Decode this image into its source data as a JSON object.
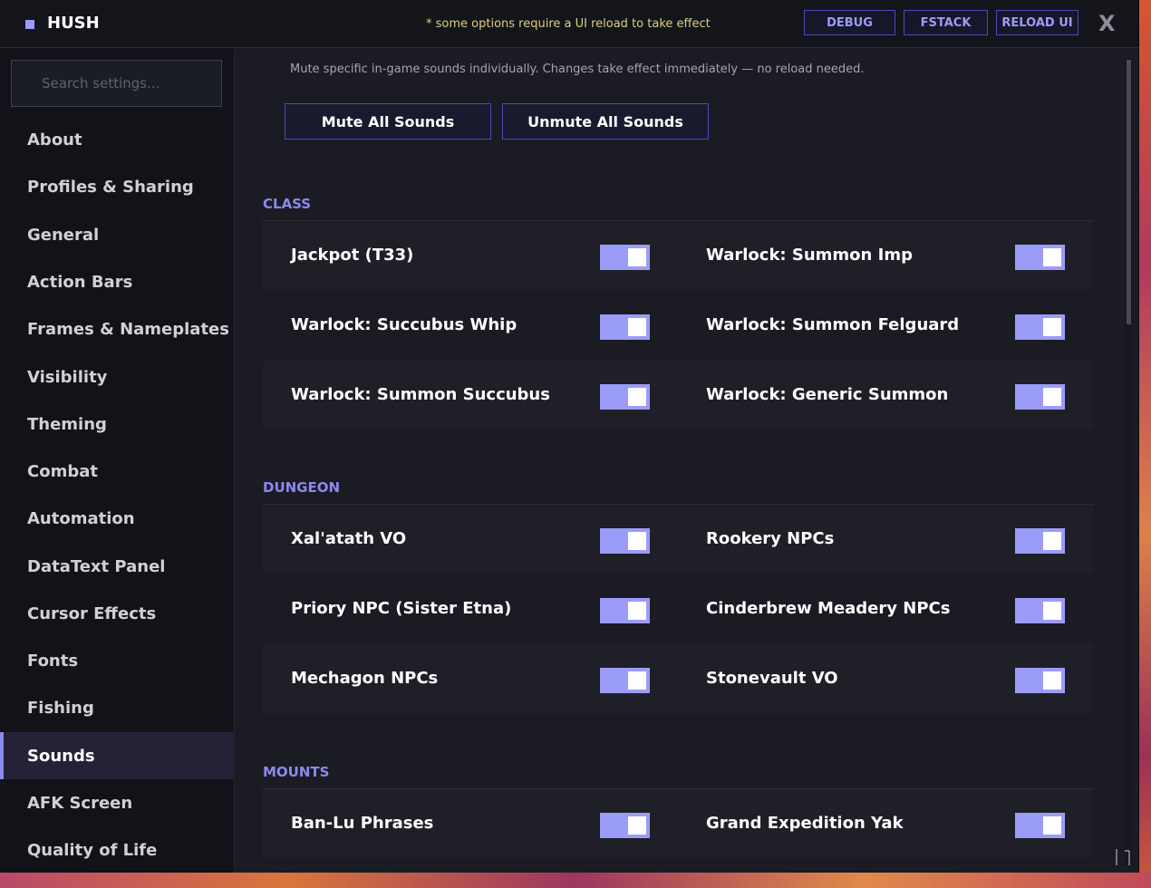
{
  "app": {
    "title": "HUSH",
    "reload_note": "* some options require a UI reload to take effect",
    "buttons": {
      "debug": "DEBUG",
      "fstack": "FSTACK",
      "reload": "RELOAD UI",
      "close": "X"
    }
  },
  "sidebar": {
    "search_placeholder": "Search settings...",
    "items": [
      {
        "label": "About"
      },
      {
        "label": "Profiles & Sharing"
      },
      {
        "label": "General"
      },
      {
        "label": "Action Bars"
      },
      {
        "label": "Frames & Nameplates"
      },
      {
        "label": "Visibility"
      },
      {
        "label": "Theming"
      },
      {
        "label": "Combat"
      },
      {
        "label": "Automation"
      },
      {
        "label": "DataText Panel"
      },
      {
        "label": "Cursor Effects"
      },
      {
        "label": "Fonts"
      },
      {
        "label": "Fishing"
      },
      {
        "label": "Sounds",
        "active": true
      },
      {
        "label": "AFK Screen"
      },
      {
        "label": "Quality of Life"
      }
    ]
  },
  "main": {
    "description": "Mute specific in-game sounds individually.  Changes take effect immediately — no reload needed.",
    "mute_all": "Mute All Sounds",
    "unmute_all": "Unmute All Sounds",
    "sections": [
      {
        "title": "CLASS",
        "options": [
          {
            "label": "Jackpot (T33)",
            "enabled": true
          },
          {
            "label": "Warlock: Summon Imp",
            "enabled": true
          },
          {
            "label": "Warlock: Succubus Whip",
            "enabled": true
          },
          {
            "label": "Warlock: Summon Felguard",
            "enabled": true
          },
          {
            "label": "Warlock: Summon Succubus",
            "enabled": true
          },
          {
            "label": "Warlock: Generic Summon",
            "enabled": true
          }
        ]
      },
      {
        "title": "DUNGEON",
        "options": [
          {
            "label": "Xal'atath VO",
            "enabled": true
          },
          {
            "label": "Rookery NPCs",
            "enabled": true
          },
          {
            "label": "Priory NPC (Sister Etna)",
            "enabled": true
          },
          {
            "label": "Cinderbrew Meadery NPCs",
            "enabled": true
          },
          {
            "label": "Mechagon NPCs",
            "enabled": true
          },
          {
            "label": "Stonevault VO",
            "enabled": true
          }
        ]
      },
      {
        "title": "MOUNTS",
        "options": [
          {
            "label": "Ban-Lu Phrases",
            "enabled": true
          },
          {
            "label": "Grand Expedition Yak",
            "enabled": true
          }
        ]
      }
    ]
  },
  "colors": {
    "accent": "#9b9cf8",
    "section_title": "#8a8af0",
    "note": "#d8d27a",
    "panel": "#1b1b23"
  }
}
